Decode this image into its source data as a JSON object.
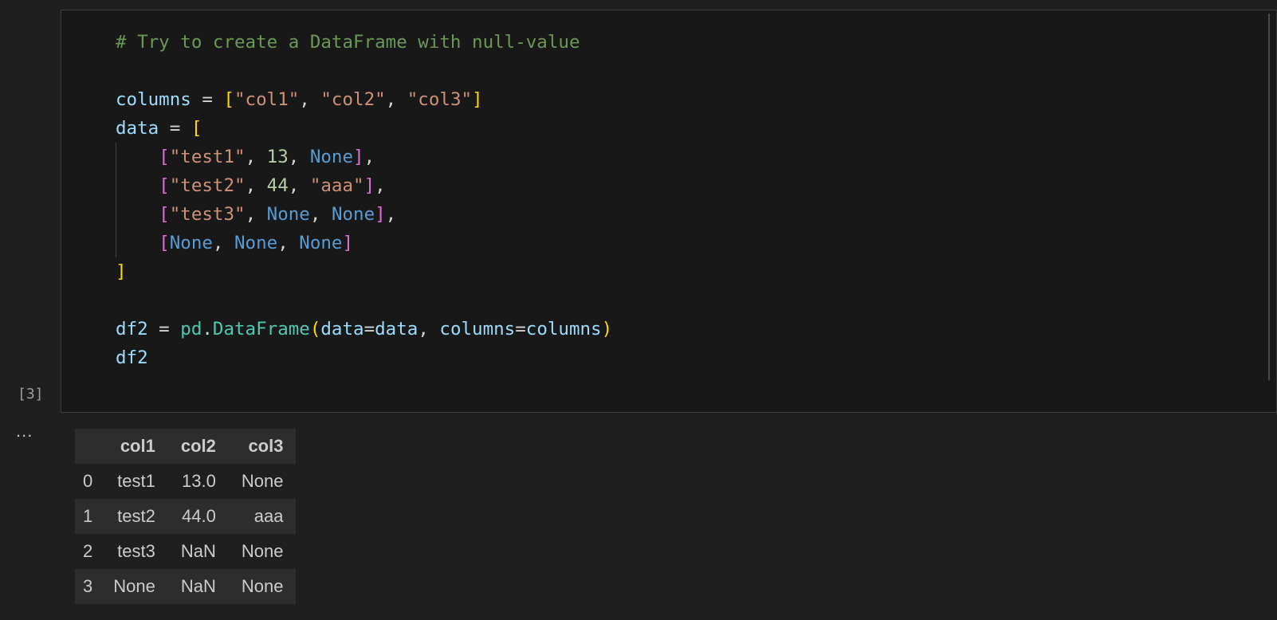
{
  "cell": {
    "execution_count": "[3]",
    "code_lines": [
      [
        {
          "t": "# Try to create a DataFrame with null-value",
          "c": "comment"
        }
      ],
      [],
      [
        {
          "t": "columns",
          "c": "var"
        },
        {
          "t": " = ",
          "c": "op"
        },
        {
          "t": "[",
          "c": "br1"
        },
        {
          "t": "\"col1\"",
          "c": "str"
        },
        {
          "t": ", ",
          "c": "op"
        },
        {
          "t": "\"col2\"",
          "c": "str"
        },
        {
          "t": ", ",
          "c": "op"
        },
        {
          "t": "\"col3\"",
          "c": "str"
        },
        {
          "t": "]",
          "c": "br1"
        }
      ],
      [
        {
          "t": "data",
          "c": "var"
        },
        {
          "t": " = ",
          "c": "op"
        },
        {
          "t": "[",
          "c": "br1"
        }
      ],
      [
        {
          "t": "    ",
          "c": "op"
        },
        {
          "t": "[",
          "c": "br2"
        },
        {
          "t": "\"test1\"",
          "c": "str"
        },
        {
          "t": ", ",
          "c": "op"
        },
        {
          "t": "13",
          "c": "num"
        },
        {
          "t": ", ",
          "c": "op"
        },
        {
          "t": "None",
          "c": "kw"
        },
        {
          "t": "]",
          "c": "br2"
        },
        {
          "t": ",",
          "c": "op"
        }
      ],
      [
        {
          "t": "    ",
          "c": "op"
        },
        {
          "t": "[",
          "c": "br2"
        },
        {
          "t": "\"test2\"",
          "c": "str"
        },
        {
          "t": ", ",
          "c": "op"
        },
        {
          "t": "44",
          "c": "num"
        },
        {
          "t": ", ",
          "c": "op"
        },
        {
          "t": "\"aaa\"",
          "c": "str"
        },
        {
          "t": "]",
          "c": "br2"
        },
        {
          "t": ",",
          "c": "op"
        }
      ],
      [
        {
          "t": "    ",
          "c": "op"
        },
        {
          "t": "[",
          "c": "br2"
        },
        {
          "t": "\"test3\"",
          "c": "str"
        },
        {
          "t": ", ",
          "c": "op"
        },
        {
          "t": "None",
          "c": "kw"
        },
        {
          "t": ", ",
          "c": "op"
        },
        {
          "t": "None",
          "c": "kw"
        },
        {
          "t": "]",
          "c": "br2"
        },
        {
          "t": ",",
          "c": "op"
        }
      ],
      [
        {
          "t": "    ",
          "c": "op"
        },
        {
          "t": "[",
          "c": "br2"
        },
        {
          "t": "None",
          "c": "kw"
        },
        {
          "t": ", ",
          "c": "op"
        },
        {
          "t": "None",
          "c": "kw"
        },
        {
          "t": ", ",
          "c": "op"
        },
        {
          "t": "None",
          "c": "kw"
        },
        {
          "t": "]",
          "c": "br2"
        }
      ],
      [
        {
          "t": "]",
          "c": "br1"
        }
      ],
      [],
      [
        {
          "t": "df2",
          "c": "var"
        },
        {
          "t": " = ",
          "c": "op"
        },
        {
          "t": "pd",
          "c": "cls"
        },
        {
          "t": ".",
          "c": "op"
        },
        {
          "t": "DataFrame",
          "c": "cls"
        },
        {
          "t": "(",
          "c": "br1"
        },
        {
          "t": "data",
          "c": "var"
        },
        {
          "t": "=",
          "c": "op"
        },
        {
          "t": "data",
          "c": "var"
        },
        {
          "t": ", ",
          "c": "op"
        },
        {
          "t": "columns",
          "c": "var"
        },
        {
          "t": "=",
          "c": "op"
        },
        {
          "t": "columns",
          "c": "var"
        },
        {
          "t": ")",
          "c": "br1"
        }
      ],
      [
        {
          "t": "df2",
          "c": "var"
        }
      ]
    ]
  },
  "output": {
    "ellipsis": "...",
    "table": {
      "index_header": "",
      "columns": [
        "col1",
        "col2",
        "col3"
      ],
      "rows": [
        {
          "index": "0",
          "values": [
            "test1",
            "13.0",
            "None"
          ]
        },
        {
          "index": "1",
          "values": [
            "test2",
            "44.0",
            "aaa"
          ]
        },
        {
          "index": "2",
          "values": [
            "test3",
            "NaN",
            "None"
          ]
        },
        {
          "index": "3",
          "values": [
            "None",
            "NaN",
            "None"
          ]
        }
      ]
    }
  },
  "colors": {
    "background": "#1f1f1f",
    "cell_background": "#181818",
    "comment": "#6a9955",
    "variable": "#9cdcfe",
    "string": "#ce9178",
    "number": "#b5cea8",
    "keyword": "#569cd6",
    "bracket_level1": "#ffd700",
    "bracket_level2": "#da70d6",
    "class": "#4ec9b0"
  }
}
